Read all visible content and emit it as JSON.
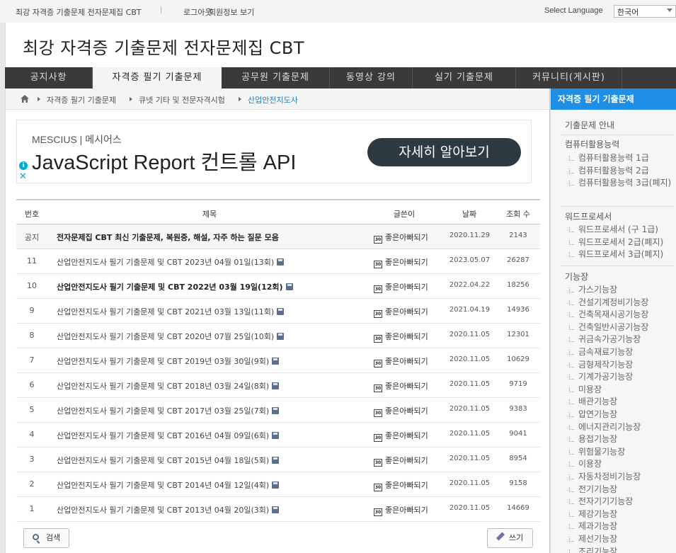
{
  "topbar": {
    "site_name": "최강 자격증 기출문제 전자문제집 CBT",
    "separator": "|",
    "logout": "로그아웃",
    "member_info": "회원정보 보기",
    "language_label": "Select Language",
    "language_value": "한국어"
  },
  "header": {
    "title": "최강 자격증 기출문제 전자문제집 CBT"
  },
  "nav": {
    "items": [
      {
        "label": "공지사항"
      },
      {
        "label": "자격증 필기 기출문제"
      },
      {
        "label": "공무원 기출문제"
      },
      {
        "label": "동영상 강의"
      },
      {
        "label": "실기 기출문제"
      },
      {
        "label": "커뮤니티(게시판)"
      }
    ]
  },
  "breadcrumb": [
    "자격증 필기 기출문제",
    "큐넷 기타 및 전문자격시험",
    "산업안전지도사"
  ],
  "ad": {
    "brand": "MESCIUS | 메시어스",
    "headline": "JavaScript Report 컨트롤 API",
    "cta": "자세히 알아보기",
    "info_glyph": "i",
    "close_glyph": "✕"
  },
  "table": {
    "headers": {
      "num": "번호",
      "title": "제목",
      "author": "글쓴이",
      "date": "날짜",
      "views": "조회 수"
    },
    "level_badge": "30",
    "rows": [
      {
        "num": "공지",
        "title": "전자문제집 CBT 최신 기출문제, 복원중, 해설, 자주 하는 질문 모음",
        "author": "좋은아빠되기",
        "date": "2020.11.29",
        "views": "2143"
      },
      {
        "num": "11",
        "title": "산업안전지도사 필기 기출문제 및 CBT 2023년 04월 01일(13회)",
        "author": "좋은아빠되기",
        "date": "2023.05.07",
        "views": "26287"
      },
      {
        "num": "10",
        "title": "산업안전지도사 필기 기출문제 및 CBT 2022년 03월 19일(12회)",
        "author": "좋은아빠되기",
        "date": "2022.04.22",
        "views": "18256"
      },
      {
        "num": "9",
        "title": "산업안전지도사 필기 기출문제 및 CBT 2021년 03월 13일(11회)",
        "author": "좋은아빠되기",
        "date": "2021.04.19",
        "views": "14936"
      },
      {
        "num": "8",
        "title": "산업안전지도사 필기 기출문제 및 CBT 2020년 07월 25일(10회)",
        "author": "좋은아빠되기",
        "date": "2020.11.05",
        "views": "12301"
      },
      {
        "num": "7",
        "title": "산업안전지도사 필기 기출문제 및 CBT 2019년 03월 30일(9회)",
        "author": "좋은아빠되기",
        "date": "2020.11.05",
        "views": "10629"
      },
      {
        "num": "6",
        "title": "산업안전지도사 필기 기출문제 및 CBT 2018년 03월 24일(8회)",
        "author": "좋은아빠되기",
        "date": "2020.11.05",
        "views": "9719"
      },
      {
        "num": "5",
        "title": "산업안전지도사 필기 기출문제 및 CBT 2017년 03월 25일(7회)",
        "author": "좋은아빠되기",
        "date": "2020.11.05",
        "views": "9383"
      },
      {
        "num": "4",
        "title": "산업안전지도사 필기 기출문제 및 CBT 2016년 04월 09일(6회)",
        "author": "좋은아빠되기",
        "date": "2020.11.05",
        "views": "9041"
      },
      {
        "num": "3",
        "title": "산업안전지도사 필기 기출문제 및 CBT 2015년 04월 18일(5회)",
        "author": "좋은아빠되기",
        "date": "2020.11.05",
        "views": "8954"
      },
      {
        "num": "2",
        "title": "산업안전지도사 필기 기출문제 및 CBT 2014년 04월 12일(4회)",
        "author": "좋은아빠되기",
        "date": "2020.11.05",
        "views": "9158"
      },
      {
        "num": "1",
        "title": "산업안전지도사 필기 기출문제 및 CBT 2013년 04월 20일(3회)",
        "author": "좋은아빠되기",
        "date": "2020.11.05",
        "views": "14669"
      }
    ]
  },
  "buttons": {
    "search": "검색",
    "write": "쓰기"
  },
  "sidebar": {
    "header": "자격증 필기 기출문제",
    "guide": "기출문제 안내",
    "cat_computer": "컴퓨터활용능력",
    "computer_items": [
      "컴퓨터활용능력 1급",
      "컴퓨터활용능력 2급",
      "컴퓨터활용능력 3급(폐지)"
    ],
    "cat_word": "워드프로세서",
    "word_items": [
      "워드프로세서 (구 1급)",
      "워드프로세서 2급(폐지)",
      "워드프로세서 3급(폐지)"
    ],
    "cat_craft": "기능장",
    "craft_items": [
      "가스기능장",
      "건설기계정비기능장",
      "건축목재시공기능장",
      "건축일반시공기능장",
      "귀금속가공기능장",
      "금속재료기능장",
      "금형제작기능장",
      "기계가공기능장",
      "미용장",
      "배관기능장",
      "압연기능장",
      "에너지관리기능장",
      "용접기능장",
      "위험물기능장",
      "이용장",
      "자동차정비기능장",
      "전기기능장",
      "전자기기기능장",
      "제강기능장",
      "제과기능장",
      "제선기능장",
      "조리기능장"
    ]
  }
}
